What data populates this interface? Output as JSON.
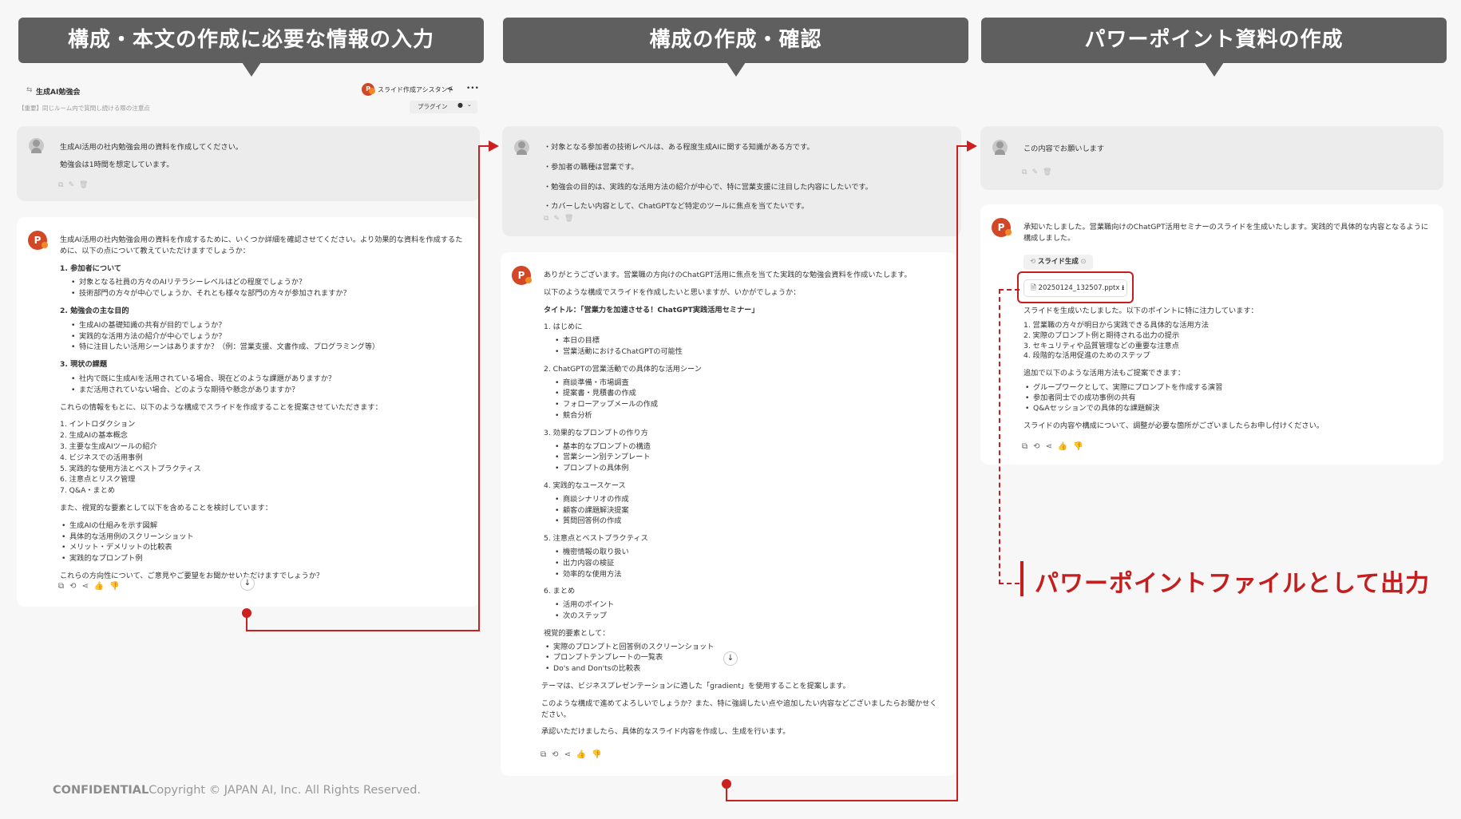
{
  "banners": {
    "col1": "構成・本文の作成に必要な情報の入力",
    "col2": "構成の作成・確認",
    "col3": "パワーポイント資料の作成"
  },
  "col1": {
    "topbar": {
      "title": "生成AI勉強会",
      "assistant": "スライド作成アシスタント",
      "share_icon": "share-icon",
      "more": "•••",
      "notice": "【重要】同じルーム内で質問し続ける際の注意点",
      "plugin": "プラグイン"
    },
    "user_msg": {
      "lines": [
        "生成AI活用の社内勉強会用の資料を作成してください。",
        "勉強会は1時間を想定しています。"
      ]
    },
    "ai_msg": {
      "intro": "生成AI活用の社内勉強会用の資料を作成するために、いくつか詳細を確認させてください。より効果的な資料を作成するために、以下の点について教えていただけますでしょうか：",
      "sections": [
        {
          "title": "1. 参加者について",
          "items": [
            "対象となる社員の方々のAIリテラシーレベルはどの程度でしょうか？",
            "技術部門の方々が中心でしょうか、それとも様々な部門の方々が参加されますか？"
          ]
        },
        {
          "title": "2. 勉強会の主な目的",
          "items": [
            "生成AIの基礎知識の共有が目的でしょうか？",
            "実践的な活用方法の紹介が中心でしょうか？",
            "特に注目したい活用シーンはありますか？（例：営業支援、文書作成、プログラミング等）"
          ]
        },
        {
          "title": "3. 現状の課題",
          "items": [
            "社内で既に生成AIを活用されている場合、現在どのような課題がありますか？",
            "まだ活用されていない場合、どのような期待や懸念がありますか？"
          ]
        }
      ],
      "proposal_intro": "これらの情報をもとに、以下のような構成でスライドを作成することを提案させていただきます：",
      "outline": [
        "1. イントロダクション",
        "2. 生成AIの基本概念",
        "3. 主要な生成AIツールの紹介",
        "4. ビジネスでの活用事例",
        "5. 実践的な使用方法とベストプラクティス",
        "6. 注意点とリスク管理",
        "7. Q&A・まとめ"
      ],
      "visual_intro": "また、視覚的な要素として以下を含めることを検討しています：",
      "visuals": [
        "生成AIの仕組みを示す図解",
        "具体的な活用例のスクリーンショット",
        "メリット・デメリットの比較表",
        "実践的なプロンプト例"
      ],
      "closing": "これらの方向性について、ご意見やご要望をお聞かせいただけますでしょうか？"
    }
  },
  "col2": {
    "user_msg": {
      "lines": [
        "・対象となる参加者の技術レベルは、ある程度生成AIに関する知識がある方です。",
        "・参加者の職種は営業です。",
        "・勉強会の目的は、実践的な活用方法の紹介が中心で、特に営業支援に注目した内容にしたいです。",
        "・カバーしたい内容として、ChatGPTなど特定のツールに焦点を当てたいです。"
      ]
    },
    "ai_msg": {
      "intro": "ありがとうございます。営業職の方向けのChatGPT活用に焦点を当てた実践的な勉強会資料を作成いたします。",
      "proposal": "以下のような構成でスライドを作成したいと思いますが、いかがでしょうか：",
      "title": "タイトル：「営業力を加速させる！ChatGPT実践活用セミナー」",
      "sections": [
        {
          "title": "1. はじめに",
          "items": [
            "本日の目標",
            "営業活動におけるChatGPTの可能性"
          ]
        },
        {
          "title": "2. ChatGPTの営業活動での具体的な活用シーン",
          "items": [
            "商談準備・市場調査",
            "提案書・見積書の作成",
            "フォローアップメールの作成",
            "競合分析"
          ]
        },
        {
          "title": "3. 効果的なプロンプトの作り方",
          "items": [
            "基本的なプロンプトの構造",
            "営業シーン別テンプレート",
            "プロンプトの具体例"
          ]
        },
        {
          "title": "4. 実践的なユースケース",
          "items": [
            "商談シナリオの作成",
            "顧客の課題解決提案",
            "質問回答例の作成"
          ]
        },
        {
          "title": "5. 注意点とベストプラクティス",
          "items": [
            "機密情報の取り扱い",
            "出力内容の検証",
            "効率的な使用方法"
          ]
        },
        {
          "title": "6. まとめ",
          "items": [
            "活用のポイント",
            "次のステップ"
          ]
        }
      ],
      "visual_title": "視覚的要素として：",
      "visuals": [
        "実際のプロンプトと回答例のスクリーンショット",
        "プロンプトテンプレートの一覧表",
        "Do's and Don'tsの比較表"
      ],
      "theme": "テーマは、ビジネスプレゼンテーションに適した「gradient」を使用することを提案します。",
      "question": "このような構成で進めてよろしいでしょうか？また、特に強調したい点や追加したい内容などございましたらお聞かせください。",
      "closing": "承認いただけましたら、具体的なスライド内容を作成し、生成を行います。"
    }
  },
  "col3": {
    "user_msg": {
      "lines": [
        "この内容でお願いします"
      ]
    },
    "ai_msg": {
      "intro": "承知いたしました。営業職向けのChatGPT活用セミナーのスライドを生成いたします。実践的で具体的な内容となるように構成しました。",
      "tool_chip": "スライド生成",
      "file_name": "20250124_132507.pptx",
      "done": "スライドを生成いたしました。以下のポイントに特に注力しています：",
      "points": [
        "1. 営業職の方々が明日から実践できる具体的な活用方法",
        "2. 実際のプロンプト例と期待される出力の提示",
        "3. セキュリティや品質管理などの重要な注意点",
        "4. 段階的な活用促進のためのステップ"
      ],
      "extra_intro": "追加で以下のような活用方法もご提案できます：",
      "extras": [
        "グループワークとして、実際にプロンプトを作成する演習",
        "参加者同士での成功事例の共有",
        "Q&Aセッションでの具体的な課題解決"
      ],
      "closing": "スライドの内容や構成について、調整が必要な箇所がございましたらお申し付けください。"
    }
  },
  "callout": "パワーポイントファイルとして出力",
  "footer": {
    "confidential": "CONFIDENTIAL",
    "copyright": "Copyright © JAPAN AI, Inc. All Rights Reserved."
  },
  "icons": {
    "copy": "copy-icon",
    "edit": "edit-icon",
    "delete": "delete-icon",
    "refresh": "refresh-icon",
    "share": "share-icon",
    "like": "thumbs-up-icon",
    "dislike": "thumbs-down-icon",
    "download": "download-icon",
    "scroll_down": "arrow-down-icon"
  },
  "colors": {
    "accent": "#cc1f1f",
    "banner": "#5f5f5f",
    "ai_avatar": "#d24726"
  }
}
